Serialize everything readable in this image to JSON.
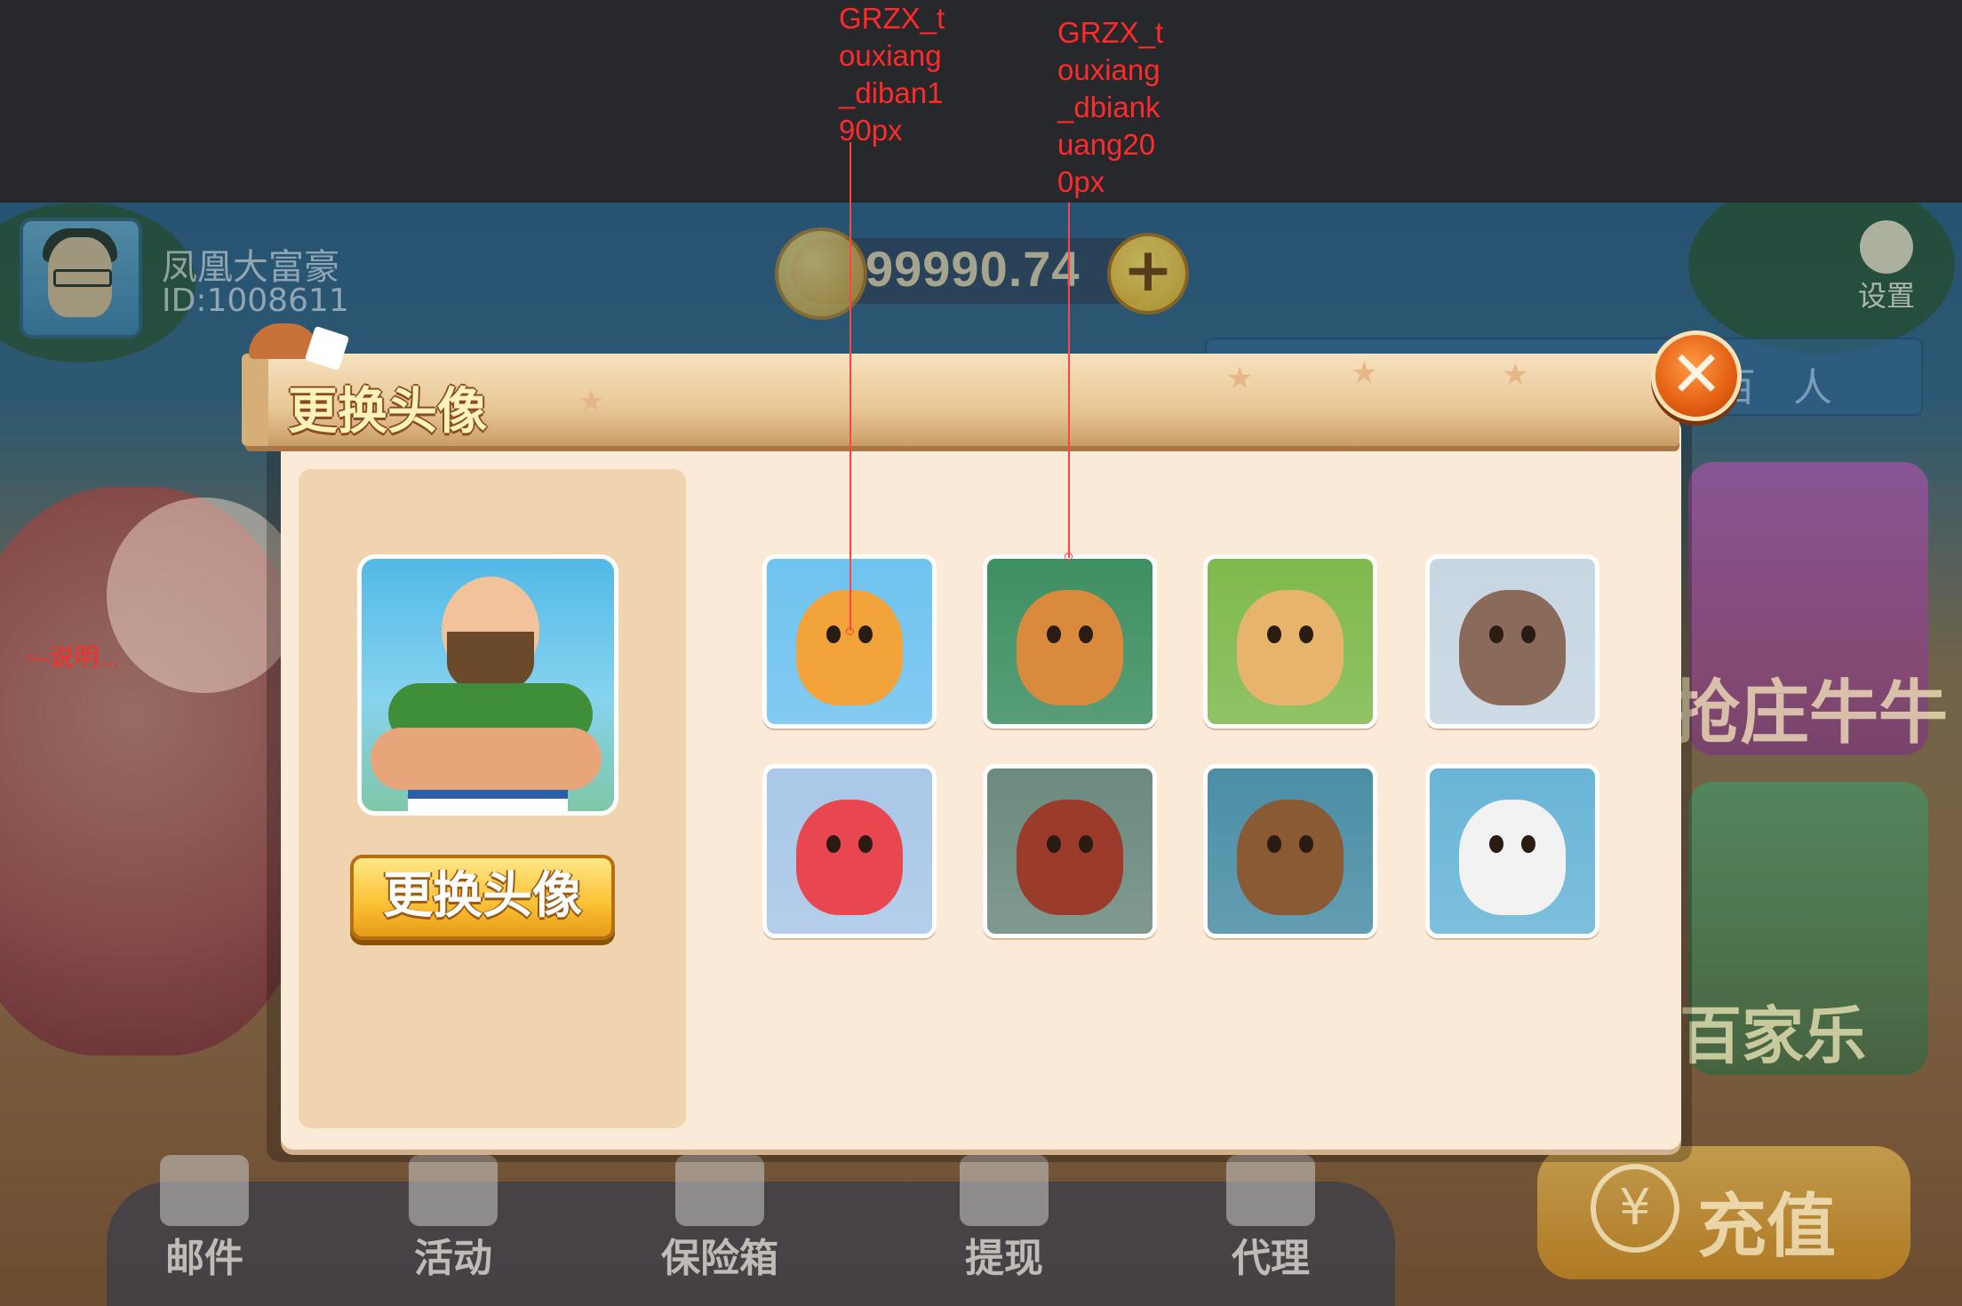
{
  "annotations": {
    "label_1": "GRZX_t\nouxiang\n_diban1\n90px",
    "label_2": "GRZX_t\nouxiang\n_dbiank\nuang20\n0px",
    "side_note": "说明..."
  },
  "player": {
    "name": "凤凰大富豪",
    "id": "ID:1008611"
  },
  "coins": {
    "value": "99990.74",
    "plus": "+"
  },
  "settings": {
    "label": "设置"
  },
  "tabs": {
    "hundred": "百 人"
  },
  "games": {
    "niuniu": "抢庄牛牛",
    "baccarat": "百家乐"
  },
  "recharge": {
    "label": "充值",
    "icon": "¥"
  },
  "bottom_nav": [
    {
      "label": "邮件",
      "icon": "mail-icon"
    },
    {
      "label": "活动",
      "icon": "gift-icon"
    },
    {
      "label": "保险箱",
      "icon": "safe-icon"
    },
    {
      "label": "提现",
      "icon": "withdraw-icon"
    },
    {
      "label": "代理",
      "icon": "agent-icon"
    }
  ],
  "modal": {
    "title": "更换头像",
    "close": "✕",
    "change_button": "更换头像",
    "current_avatar": "muscle-man-avatar",
    "avatars": [
      {
        "name": "corgi-avatar",
        "color": "#f2a33a",
        "bg": "#6fc3ef"
      },
      {
        "name": "cat-pilot-avatar",
        "color": "#d98a3c",
        "bg": "#3e8f63"
      },
      {
        "name": "calf-avatar",
        "color": "#e7b46e",
        "bg": "#7fb94d"
      },
      {
        "name": "husky-avatar",
        "color": "#8a6a5a",
        "bg": "#c7d6e2"
      },
      {
        "name": "dragon-avatar",
        "color": "#e8474f",
        "bg": "#a9c7e8"
      },
      {
        "name": "horse-avatar",
        "color": "#9b3b2c",
        "bg": "#6c8a7f"
      },
      {
        "name": "bear-avatar",
        "color": "#8a5a34",
        "bg": "#4b8ea6"
      },
      {
        "name": "husky-rose-avatar",
        "color": "#f2f2f2",
        "bg": "#69b5d7"
      }
    ]
  }
}
